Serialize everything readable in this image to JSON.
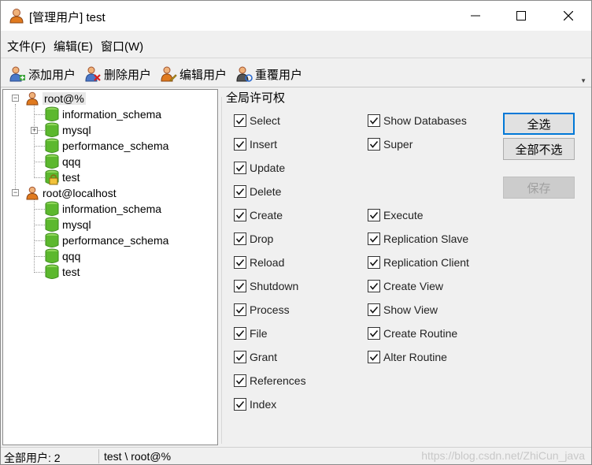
{
  "window": {
    "title": "[管理用户] test",
    "minimize_glyph": "—",
    "maximize_glyph": "☐",
    "close_glyph": "✕"
  },
  "menu": [
    {
      "label": "文件(F)"
    },
    {
      "label": "编辑(E)"
    },
    {
      "label": "窗口(W)"
    }
  ],
  "toolbar": {
    "add_user": "添加用户",
    "delete_user": "删除用户",
    "edit_user": "编辑用户",
    "reset_user": "重覆用户",
    "overflow": "▼"
  },
  "tree": {
    "users": [
      {
        "label": "root@%",
        "databases": [
          "information_schema",
          "mysql",
          "performance_schema",
          "qqq",
          "test"
        ]
      },
      {
        "label": "root@localhost",
        "databases": [
          "information_schema",
          "mysql",
          "performance_schema",
          "qqq",
          "test"
        ]
      }
    ]
  },
  "permissions": {
    "legend": "全局许可权",
    "left_column": [
      "Select",
      "Insert",
      "Update",
      "Delete",
      "Create",
      "Drop",
      "Reload",
      "Shutdown",
      "Process",
      "File",
      "Grant",
      "References",
      "Index"
    ],
    "right_column": [
      "Show Databases",
      "Super",
      "Execute",
      "Replication Slave",
      "Replication Client",
      "Create View",
      "Show View",
      "Create Routine",
      "Alter Routine"
    ],
    "select_all": "全选",
    "deselect_all": "全部不选",
    "save": "保存"
  },
  "status": {
    "total_users": "全部用户: 2",
    "path": "test \\ root@%",
    "watermark": "https://blog.csdn.net/ZhiCun_java"
  },
  "colors": {
    "accent": "#0078d7",
    "db_icon": "#5cb82e",
    "user_icon": "#e07a1f"
  }
}
